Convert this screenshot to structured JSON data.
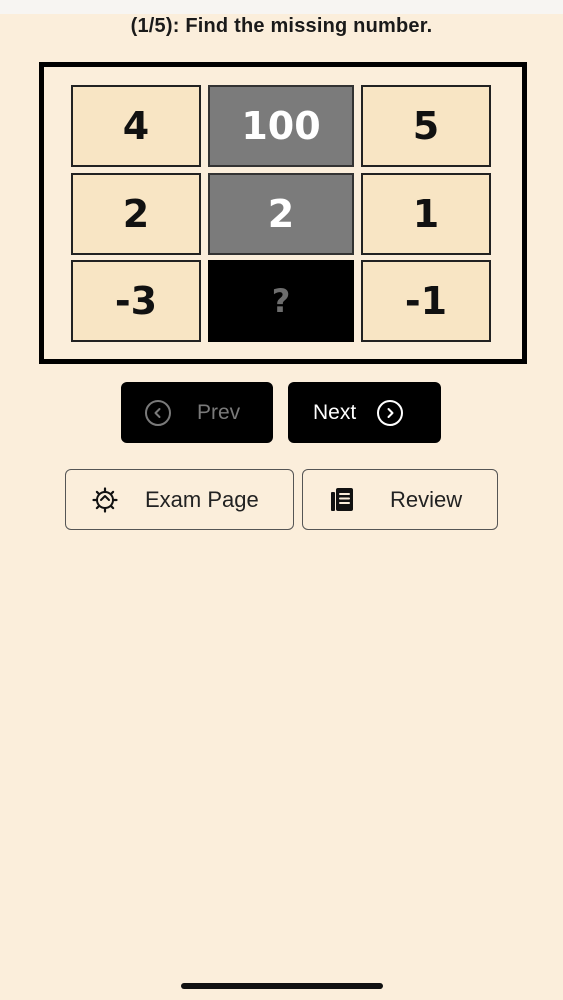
{
  "question": {
    "title": "(1/5): Find the missing number."
  },
  "puzzle": {
    "cells": [
      [
        "4",
        "100",
        "5"
      ],
      [
        "2",
        "2",
        "1"
      ],
      [
        "-3",
        "?",
        "-1"
      ]
    ]
  },
  "navigation": {
    "prev_label": "Prev",
    "next_label": "Next",
    "prev_icon": "chevron-left-circle-icon",
    "next_icon": "chevron-right-circle-icon"
  },
  "actions": {
    "exam_page_label": "Exam Page",
    "review_label": "Review",
    "exam_page_icon": "gear-icon",
    "review_icon": "document-list-icon"
  },
  "colors": {
    "background": "#fbeedb",
    "cell": "#f8e5c4",
    "middle_cell": "#7b7b7b",
    "missing_cell": "#000000"
  }
}
